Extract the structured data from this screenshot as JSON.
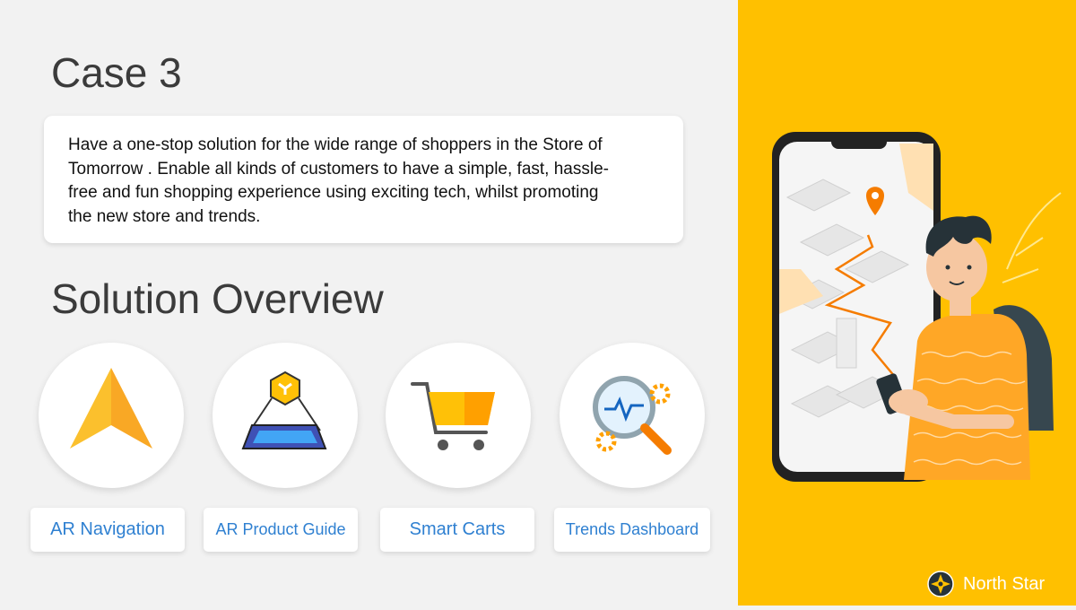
{
  "case_title": "Case 3",
  "description": "Have a one-stop solution for the wide range of shoppers in the Store of Tomorrow . Enable all kinds of customers to have a simple, fast, hassle-free and fun shopping experience using exciting tech, whilst promoting the new store and trends.",
  "overview_title": "Solution Overview",
  "features": [
    {
      "label": "AR Navigation",
      "icon": "navigation-arrow-icon"
    },
    {
      "label": "AR Product Guide",
      "icon": "ar-hologram-icon"
    },
    {
      "label": "Smart Carts",
      "icon": "shopping-cart-icon"
    },
    {
      "label": "Trends Dashboard",
      "icon": "analytics-magnifier-icon"
    }
  ],
  "brand": {
    "name": "North Star",
    "icon": "north-star-compass-icon"
  },
  "colors": {
    "accent_yellow": "#ffc000",
    "label_blue": "#2f80d1",
    "title_gray": "#3b3b3b",
    "icon_orange": "#f9a825"
  }
}
